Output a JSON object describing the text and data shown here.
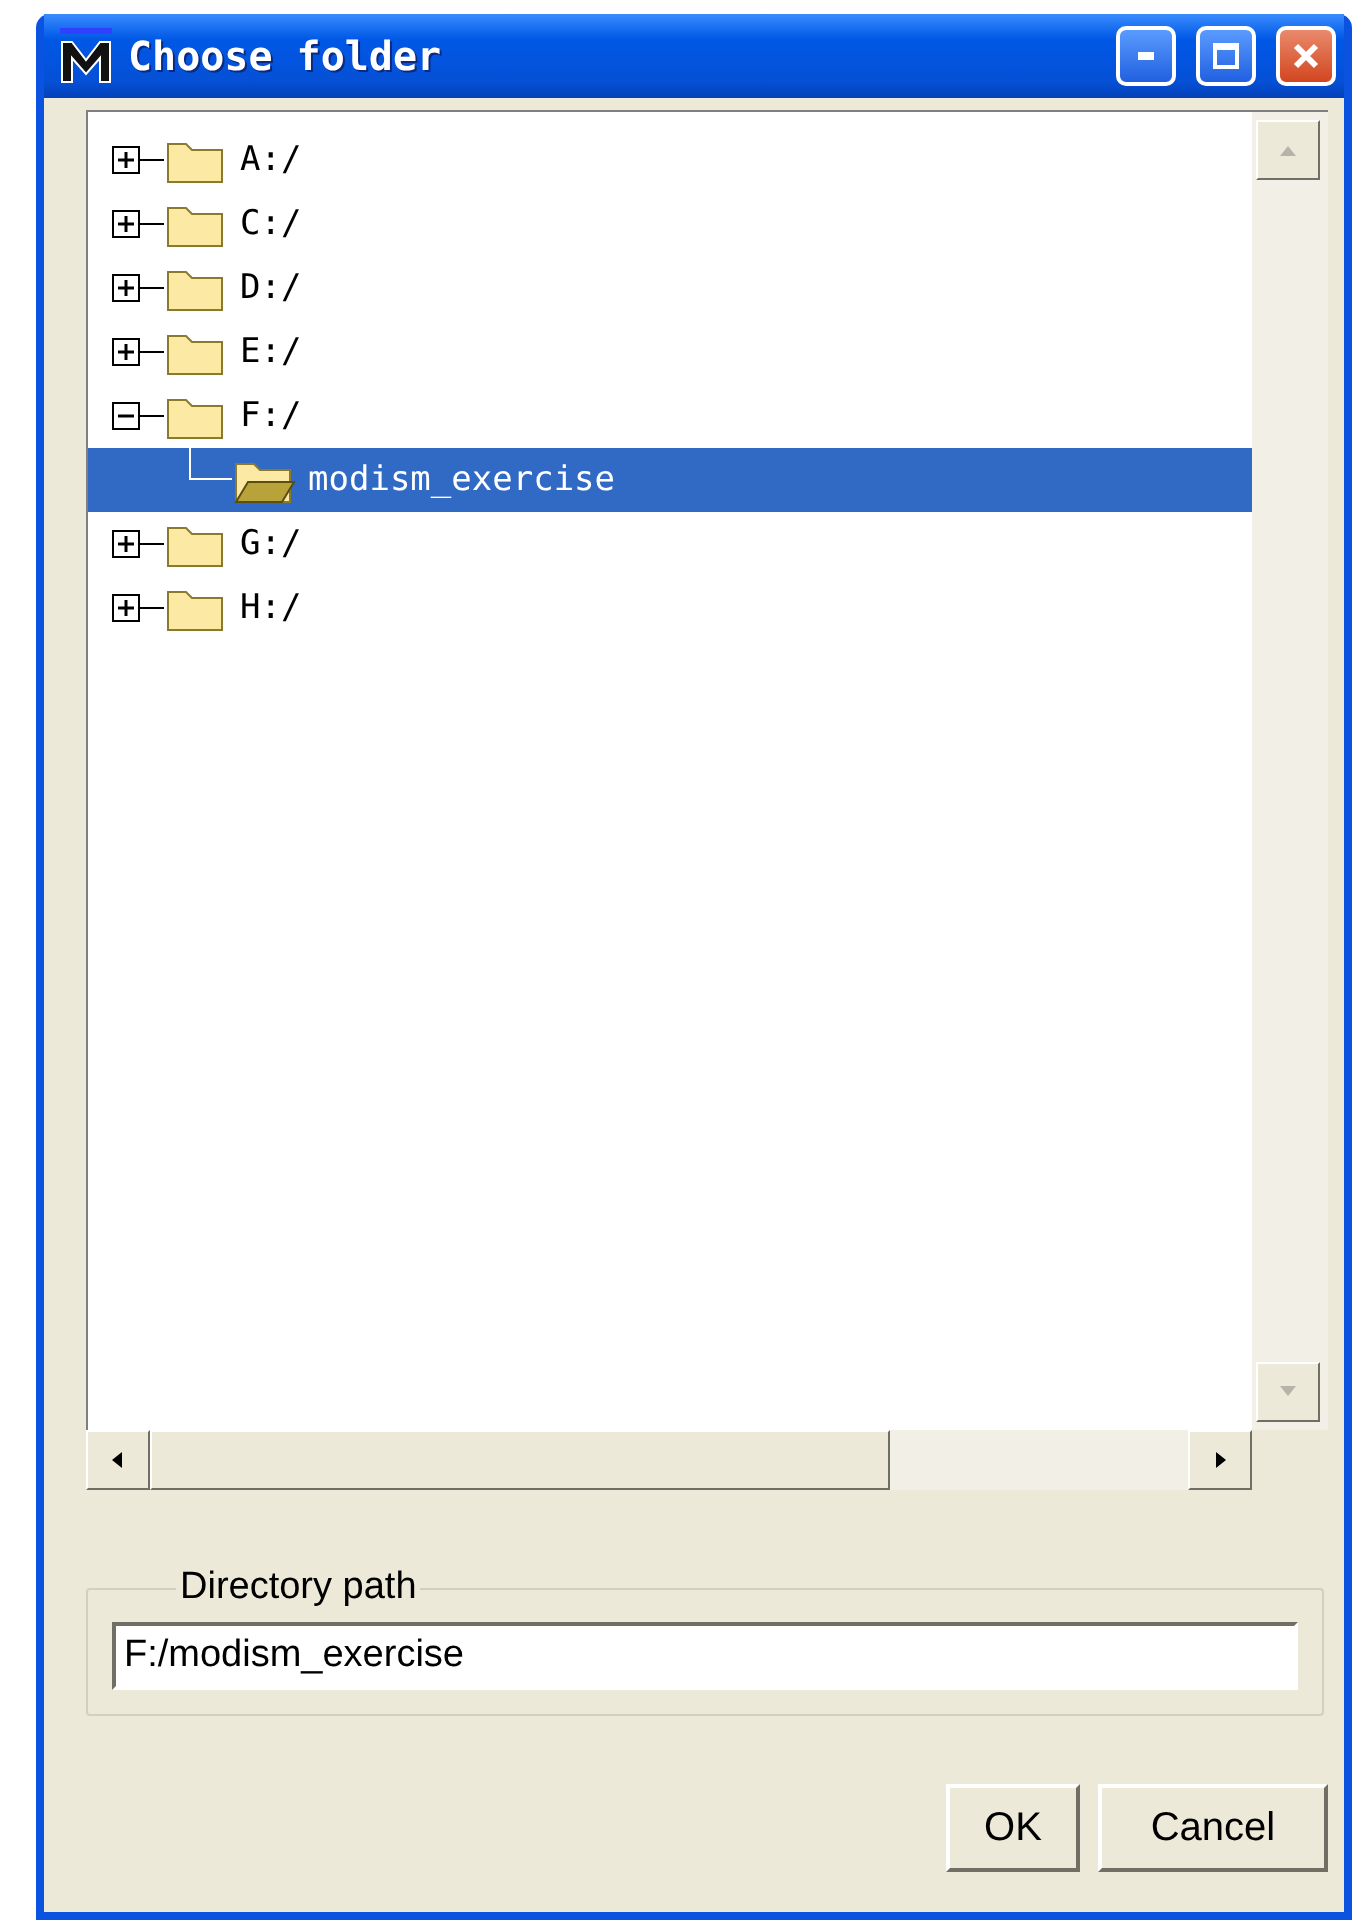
{
  "window": {
    "title": "Choose folder"
  },
  "tree": {
    "items": [
      {
        "label": "A:/",
        "expanded": false,
        "selected": false
      },
      {
        "label": "C:/",
        "expanded": false,
        "selected": false
      },
      {
        "label": "D:/",
        "expanded": false,
        "selected": false
      },
      {
        "label": "E:/",
        "expanded": false,
        "selected": false
      },
      {
        "label": "F:/",
        "expanded": true,
        "selected": false,
        "children": [
          {
            "label": "modism_exercise",
            "selected": true
          }
        ]
      },
      {
        "label": "G:/",
        "expanded": false,
        "selected": false
      },
      {
        "label": "H:/",
        "expanded": false,
        "selected": false
      }
    ]
  },
  "directory_path": {
    "legend": "Directory path",
    "value": "F:/modism_exercise"
  },
  "buttons": [
    "OK",
    "Cancel"
  ]
}
